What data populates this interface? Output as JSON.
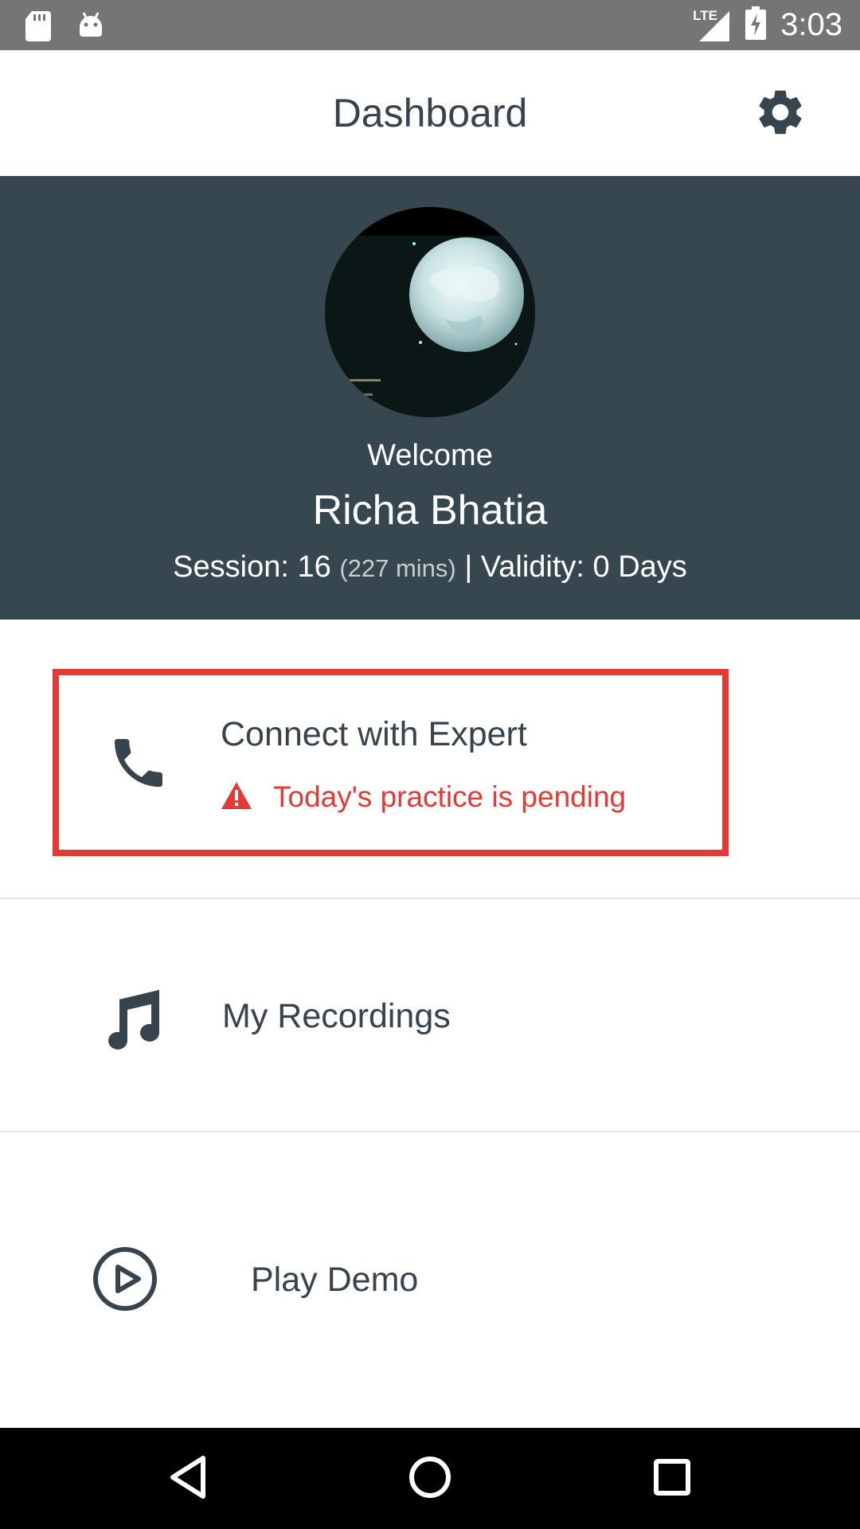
{
  "status_bar": {
    "time": "3:03",
    "network": "LTE",
    "icons": [
      "sd-card-icon",
      "android-icon",
      "signal-icon",
      "battery-charging-icon"
    ]
  },
  "app_bar": {
    "title": "Dashboard",
    "settings_icon": "gear-icon"
  },
  "profile": {
    "welcome": "Welcome",
    "name": "Richa Bhatia",
    "session_label": "Session: 16",
    "session_minutes": "(227 mins)",
    "validity": "| Validity: 0 Days"
  },
  "menu": {
    "connect": {
      "title": "Connect with Expert",
      "warning": "Today's practice is pending",
      "icon": "phone-icon",
      "warning_icon": "warning-icon"
    },
    "recordings": {
      "label": "My Recordings",
      "icon": "music-note-icon"
    },
    "demo": {
      "label": "Play Demo",
      "icon": "play-circle-icon"
    }
  },
  "colors": {
    "header_bg": "#37474f",
    "accent_red": "#e53935",
    "text_dark": "#37434d",
    "status_bar": "#757575"
  }
}
